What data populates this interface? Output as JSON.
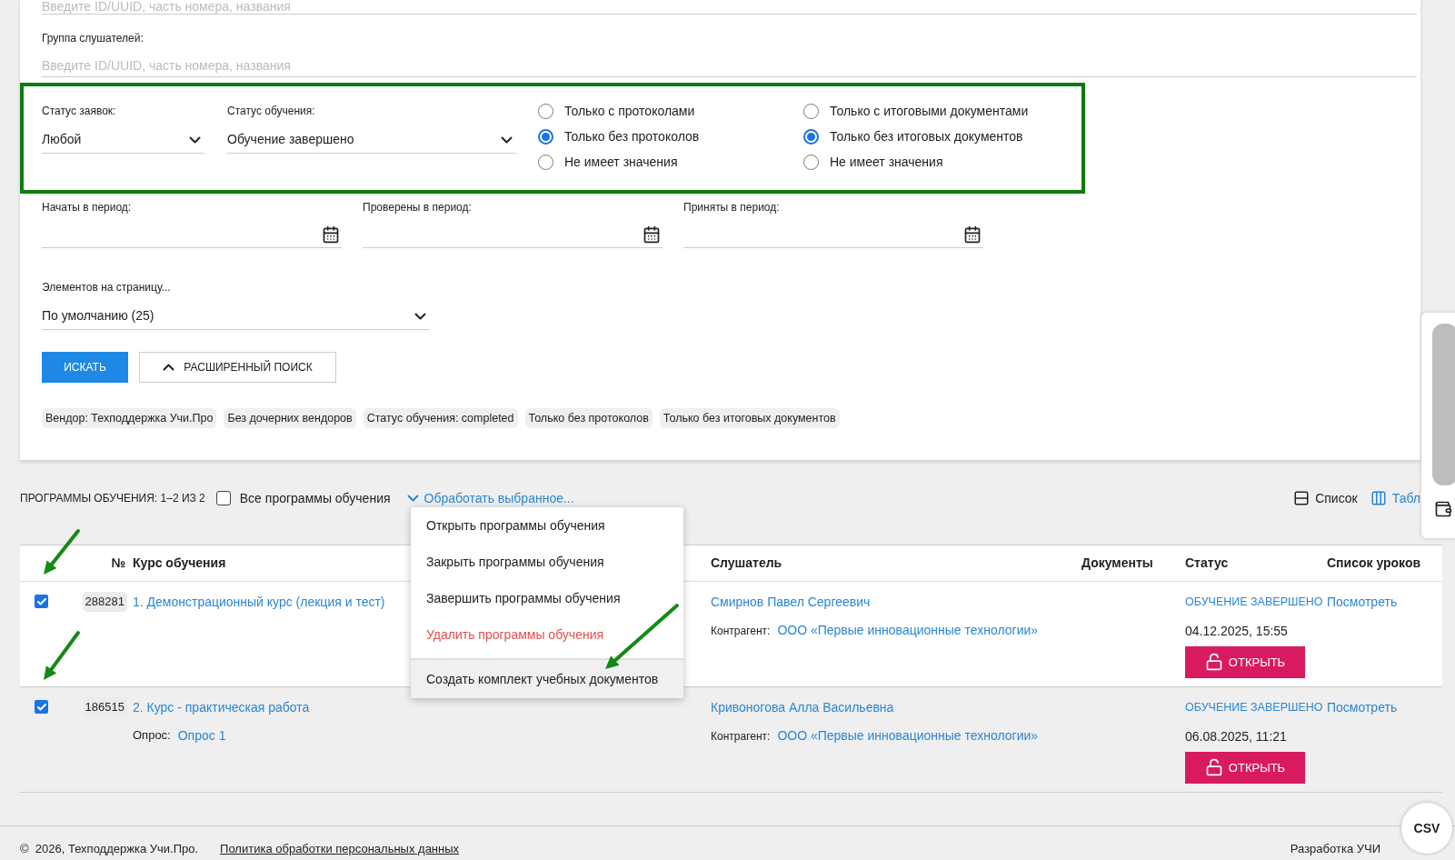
{
  "top_field": {
    "placeholder": "Введите ID/UUID, часть номера, названия"
  },
  "group_field": {
    "label": "Группа слушателей:",
    "placeholder": "Введите ID/UUID, часть номера, названия"
  },
  "status_filters": {
    "request_status": {
      "label": "Статус заявок:",
      "value": "Любой"
    },
    "training_status": {
      "label": "Статус обучения:",
      "value": "Обучение завершено"
    },
    "protocol_options": [
      {
        "label": "Только с протоколами",
        "selected": false
      },
      {
        "label": "Только без протоколов",
        "selected": true
      },
      {
        "label": "Не имеет значения",
        "selected": false
      }
    ],
    "document_options": [
      {
        "label": "Только с итоговыми документами",
        "selected": false
      },
      {
        "label": "Только без итоговых документов",
        "selected": true
      },
      {
        "label": "Не имеет значения",
        "selected": false
      }
    ]
  },
  "periods": [
    {
      "label": "Начаты в период:"
    },
    {
      "label": "Проверены в период:"
    },
    {
      "label": "Приняты в период:"
    }
  ],
  "page_size": {
    "label": "Элементов на страницу...",
    "value": "По умолчанию (25)"
  },
  "search_button": "ИСКАТЬ",
  "advanced_search": {
    "label": "РАСШИРЕННЫЙ ПОИСК",
    "expanded": true
  },
  "chips": [
    "Вендор: Техподдержка Учи.Про",
    "Без дочерних вендоров",
    "Статус обучения: completed",
    "Только без протоколов",
    "Только без итоговых документов"
  ],
  "results": {
    "count_label": "ПРОГРАММЫ ОБУЧЕНИЯ: 1–2 ИЗ 2",
    "select_all": {
      "label": "Все программы обучения",
      "checked": false
    },
    "bulk_action": "Обработать выбранное...",
    "views": [
      {
        "label": "Список",
        "selected": false,
        "kind": "list"
      },
      {
        "label": "Табл",
        "selected": true,
        "kind": "table"
      }
    ]
  },
  "bulk_menu": [
    {
      "label": "Открыть программы обучения",
      "kind": "action",
      "selected": false
    },
    {
      "label": "Закрыть программы обучения",
      "kind": "action",
      "selected": false
    },
    {
      "label": "Завершить программы обучения",
      "kind": "action",
      "selected": false
    },
    {
      "label": "Удалить программы обучения",
      "kind": "danger",
      "selected": false
    },
    {
      "label": "Создать комплект учебных документов",
      "kind": "action",
      "selected": true
    }
  ],
  "table": {
    "headers": {
      "number": "№",
      "course": "Курс обучения",
      "listener": "Слушатель",
      "documents": "Документы",
      "status": "Статус",
      "lessons": "Список уроков"
    },
    "rows": [
      {
        "checked": true,
        "id": "288281",
        "course": "1. Демонстрационный курс (лекция и тест)",
        "listener": "Смирнов Павел Сергеевич",
        "contractor_label": "Контрагент:",
        "contractor": "ООО «Первые инновационные технологии»",
        "status": "ОБУЧЕНИЕ ЗАВЕРШЕНО",
        "date": "04.12.2025, 15:55",
        "open_button": "ОТКРЫТЬ",
        "lessons_link": "Посмотреть"
      },
      {
        "checked": true,
        "id": "186515",
        "course": "2. Курс - практическая работа",
        "survey_label": "Опрос:",
        "survey": "Опрос 1",
        "listener": "Кривоногова Алла Васильевна",
        "contractor_label": "Контрагент:",
        "contractor": "ООО «Первые инновационные технологии»",
        "status": "ОБУЧЕНИЕ ЗАВЕРШЕНО",
        "date": "06.08.2025, 11:21",
        "open_button": "ОТКРЫТЬ",
        "lessons_link": "Посмотреть"
      }
    ]
  },
  "footer": {
    "copyright": "©  2026, Техподдержка Учи.Про.",
    "policy_link": "Политика обработки персональных данных",
    "developer": "Разработка УЧИ"
  },
  "csv_button": "CSV"
}
